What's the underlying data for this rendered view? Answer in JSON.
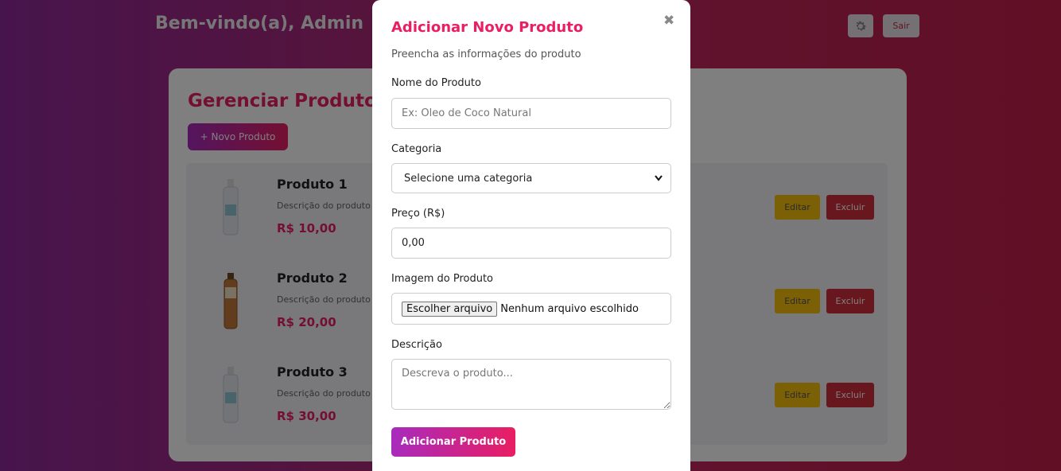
{
  "header": {
    "welcome": "Bem-vindo(a), Admin",
    "settings_icon": "gear-icon",
    "logout_label": "Sair"
  },
  "panel": {
    "title": "Gerenciar Produtos",
    "new_button": "+ Novo Produto",
    "products": [
      {
        "name": "Produto 1",
        "description": "Descrição do produto",
        "price": "R$ 10,00",
        "edit": "Editar",
        "delete": "Excluir"
      },
      {
        "name": "Produto 2",
        "description": "Descrição do produto",
        "price": "R$ 20,00",
        "edit": "Editar",
        "delete": "Excluir"
      },
      {
        "name": "Produto 3",
        "description": "Descrição do produto",
        "price": "R$ 30,00",
        "edit": "Editar",
        "delete": "Excluir"
      }
    ]
  },
  "modal": {
    "close_icon": "✖",
    "title": "Adicionar Novo Produto",
    "subtitle": "Preencha as informações do produto",
    "name_label": "Nome do Produto",
    "name_placeholder": "Ex: Óleo de Coco Natural",
    "category_label": "Categoria",
    "category_selected": "Selecione uma categoria",
    "price_label": "Preço (R$)",
    "price_value": "0,00",
    "image_label": "Imagem do Produto",
    "file_button": "Escolher arquivo",
    "file_status": "Nenhum arquivo escolhido",
    "description_label": "Descrição",
    "description_placeholder": "Descreva o produto...",
    "submit_label": "Adicionar Produto"
  },
  "colors": {
    "accent": "#e91e63",
    "edit": "#f8c00c",
    "delete": "#d32f3c"
  }
}
